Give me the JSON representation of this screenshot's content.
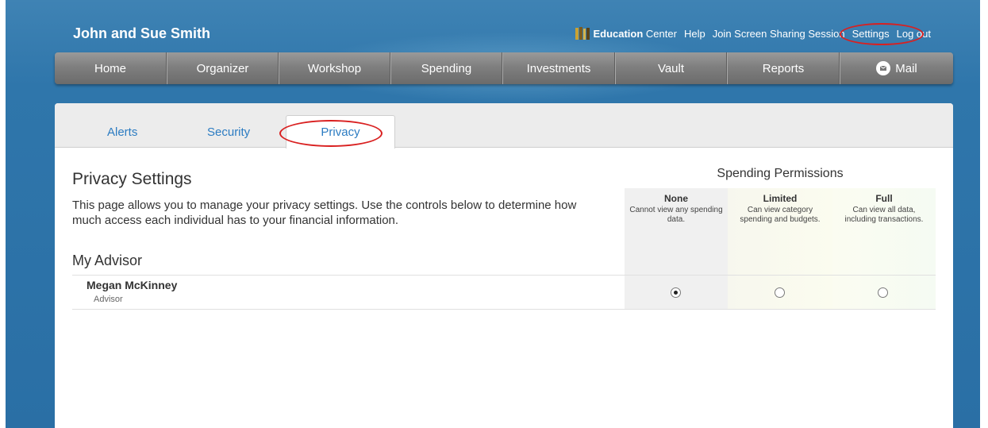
{
  "header": {
    "household_name": "John and Sue Smith",
    "links": {
      "education_bold": "Education",
      "education_rest": "Center",
      "help": "Help",
      "screen_share": "Join Screen Sharing Session",
      "settings": "Settings",
      "logout": "Log out"
    }
  },
  "nav": {
    "items": [
      "Home",
      "Organizer",
      "Workshop",
      "Spending",
      "Investments",
      "Vault",
      "Reports",
      "Mail"
    ]
  },
  "tabs": {
    "alerts": "Alerts",
    "security": "Security",
    "privacy": "Privacy",
    "active": "Privacy"
  },
  "main": {
    "title": "Privacy Settings",
    "description": "This page allows you to manage your privacy settings.  Use the controls below to determine how much access each individual has to your financial information.",
    "section_title": "My Advisor"
  },
  "permissions": {
    "title": "Spending Permissions",
    "columns": [
      {
        "label": "None",
        "desc": "Cannot view any spending data."
      },
      {
        "label": "Limited",
        "desc": "Can view category spending and budgets."
      },
      {
        "label": "Full",
        "desc": "Can view all data, including transactions."
      }
    ]
  },
  "advisors": [
    {
      "name": "Megan McKinney",
      "role": "Advisor",
      "selected": "None"
    }
  ],
  "colors": {
    "accent_link": "#2c7cc2",
    "highlight_circle": "#d92020",
    "nav_bar": "#7f7f7f",
    "background": "#2f76ab"
  }
}
